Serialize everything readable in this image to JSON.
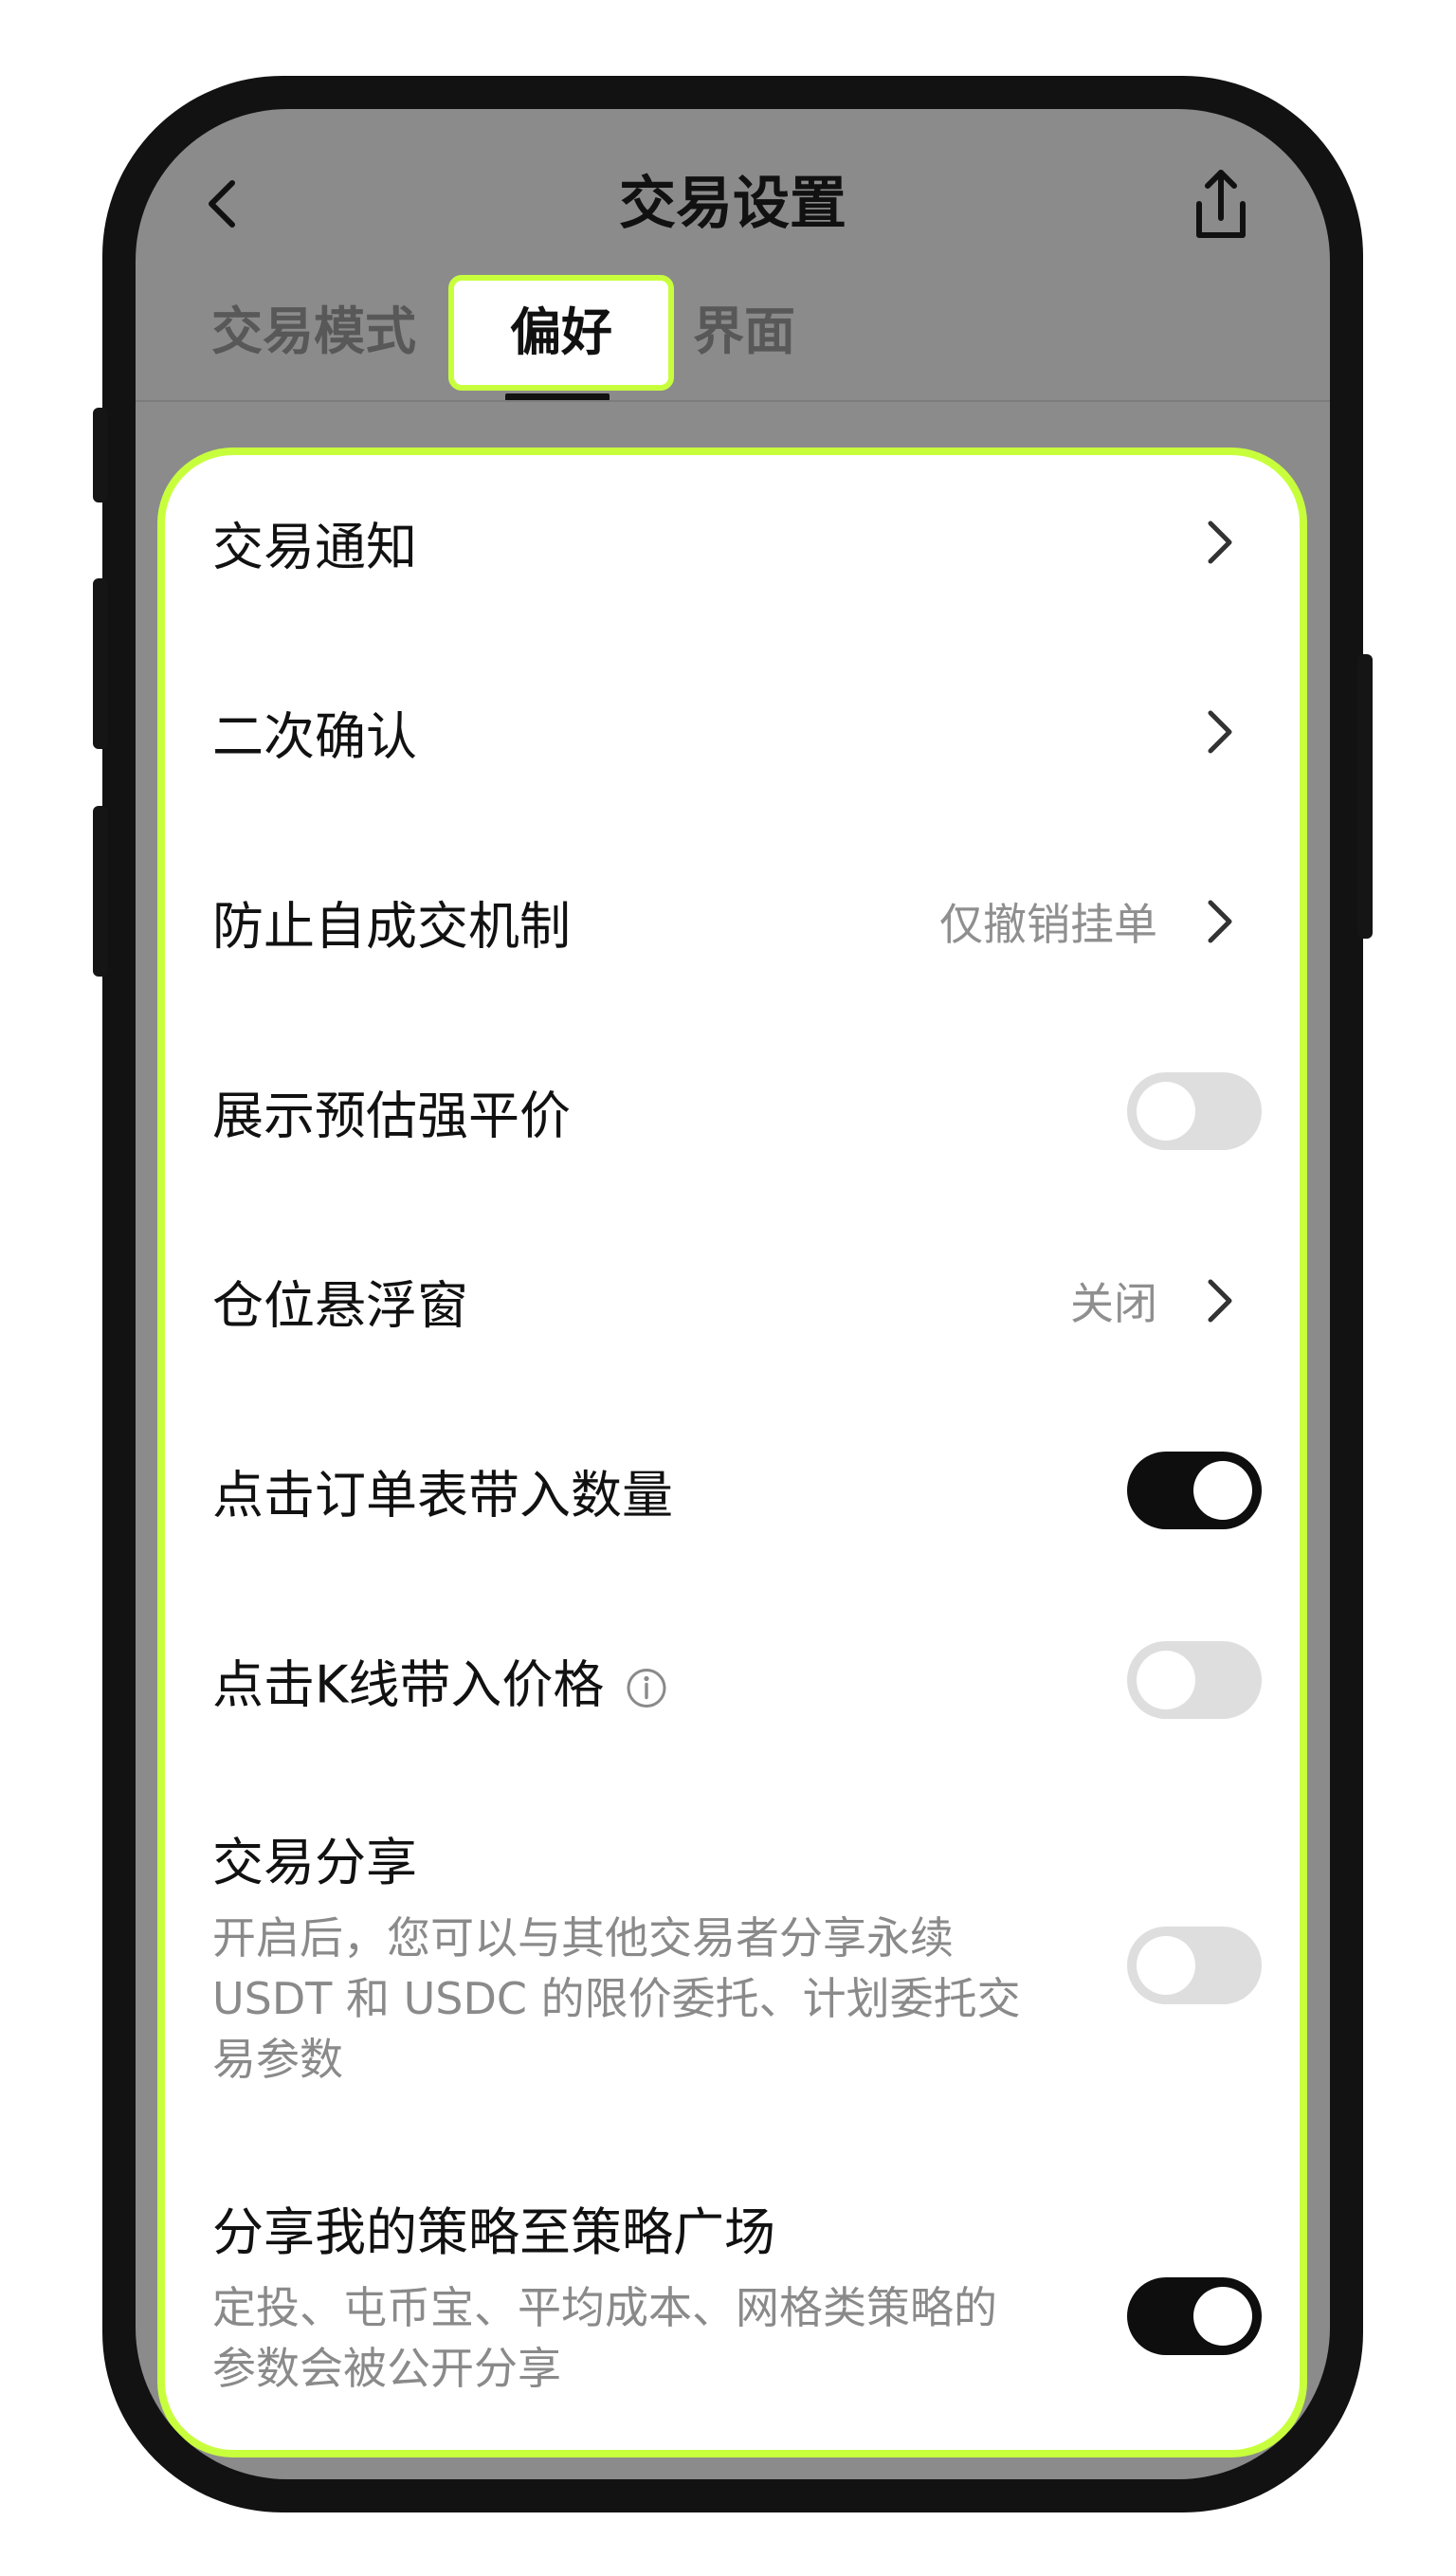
{
  "header": {
    "title": "交易设置",
    "back_icon": "chevron-left-icon",
    "share_icon": "share-icon"
  },
  "tabs": [
    {
      "label": "交易模式",
      "active": false
    },
    {
      "label": "偏好",
      "active": true
    },
    {
      "label": "界面",
      "active": false
    }
  ],
  "settings": {
    "trade_notify": {
      "label": "交易通知"
    },
    "double_confirm": {
      "label": "二次确认"
    },
    "self_trade": {
      "label": "防止自成交机制",
      "value": "仅撤销挂单"
    },
    "est_liq_price": {
      "label": "展示预估强平价",
      "enabled": false
    },
    "position_float": {
      "label": "仓位悬浮窗",
      "value": "关闭"
    },
    "click_orderbook": {
      "label": "点击订单表带入数量",
      "enabled": true
    },
    "click_kline": {
      "label": "点击K线带入价格",
      "enabled": false
    },
    "trade_share": {
      "label": "交易分享",
      "desc_line1": "开启后，您可以与其他交易者分享永续",
      "desc_line2": "USDT 和 USDC 的限价委托、计划委托交",
      "desc_line3": "易参数",
      "enabled": false
    },
    "strategy_share": {
      "label": "分享我的策略至策略广场",
      "desc_line1": "定投、屯币宝、平均成本、网格类策略的",
      "desc_line2": "参数会被公开分享",
      "enabled": true
    }
  },
  "colors": {
    "highlight": "#c8ff3c",
    "toggle_on": "#0e0e0e",
    "toggle_off": "#dedede",
    "overlay": "#8b8b8b"
  }
}
